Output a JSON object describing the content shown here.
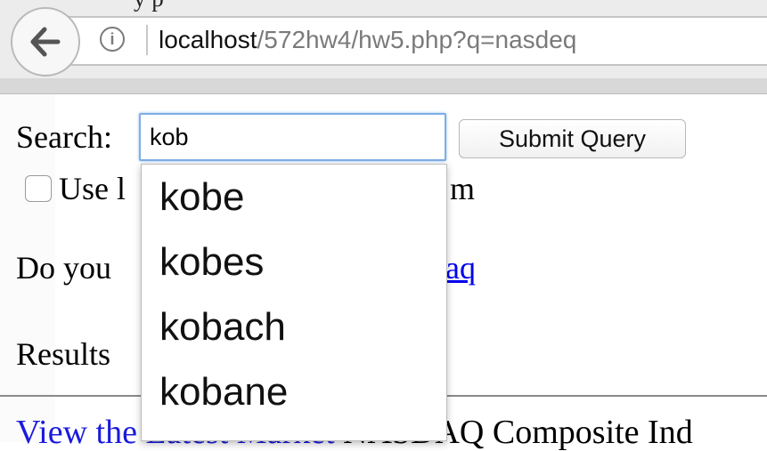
{
  "browser": {
    "top_cut_text": "y p",
    "url_host": "localhost",
    "url_path": "/572hw4/hw5.php?q=nasdeq"
  },
  "form": {
    "search_label": "Search:",
    "search_value": "kob",
    "submit_label": "Submit Query",
    "checkbox_label_start": "Use l",
    "checkbox_label_end": "m"
  },
  "suggestion": {
    "prefix": "Do you",
    "link_text": "aq"
  },
  "results": {
    "label": "Results",
    "bottom_link": "View the Latest Market",
    "bottom_text": "NASDAQ Composite Ind"
  },
  "autocomplete": {
    "items": [
      "kobe",
      "kobes",
      "kobach",
      "kobane"
    ]
  }
}
